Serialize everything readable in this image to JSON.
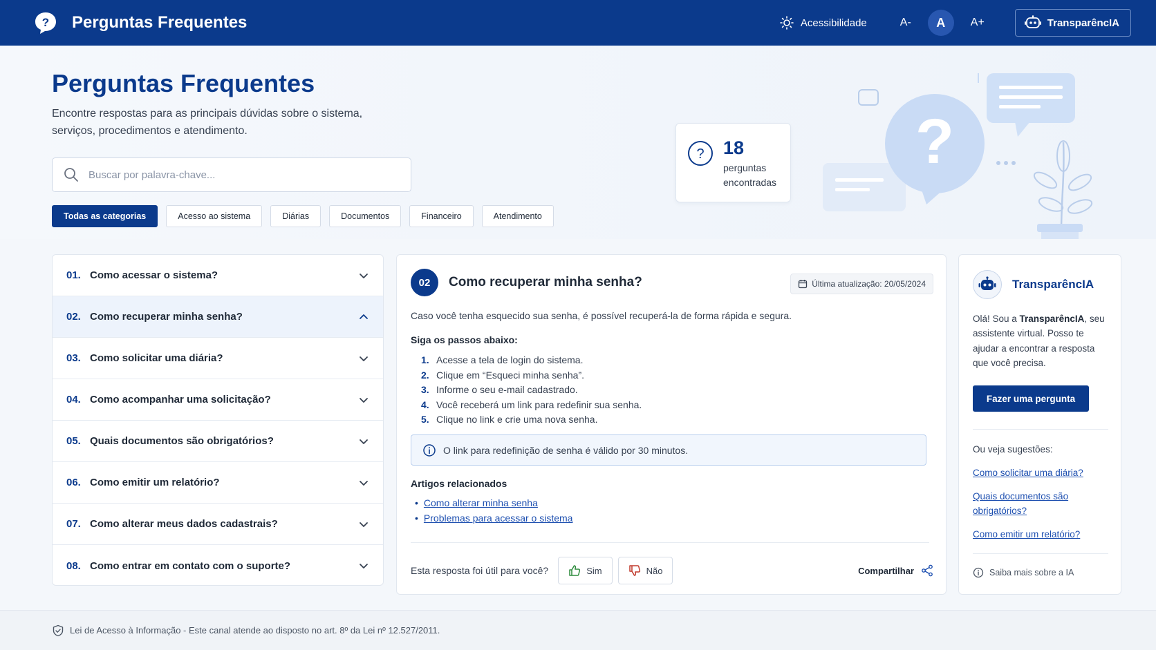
{
  "header": {
    "title": "Perguntas Frequentes",
    "accessibility_label": "Acessibilidade",
    "font_decrease": "A-",
    "font_normal": "A",
    "font_increase": "A+",
    "assistant_button": "TransparêncIA",
    "bg_color": "#0b3a8c"
  },
  "hero": {
    "title": "Perguntas Frequentes",
    "subtitle": "Encontre respostas para as principais dúvidas sobre o sistema, serviços, procedimentos e atendimento.",
    "search_placeholder": "Buscar por palavra-chave...",
    "categories": [
      {
        "label": "Todas as categorias",
        "active": true
      },
      {
        "label": "Acesso ao sistema",
        "active": false
      },
      {
        "label": "Diárias",
        "active": false
      },
      {
        "label": "Documentos",
        "active": false
      },
      {
        "label": "Financeiro",
        "active": false
      },
      {
        "label": "Atendimento",
        "active": false
      }
    ],
    "count": "18",
    "count_label": "perguntas encontradas"
  },
  "faq": {
    "items": [
      {
        "num": "01.",
        "question": "Como acessar o sistema?",
        "active": false
      },
      {
        "num": "02.",
        "question": "Como recuperar minha senha?",
        "active": true
      },
      {
        "num": "03.",
        "question": "Como solicitar uma diária?",
        "active": false
      },
      {
        "num": "04.",
        "question": "Como acompanhar uma solicitação?",
        "active": false
      },
      {
        "num": "05.",
        "question": "Quais documentos são obrigatórios?",
        "active": false
      },
      {
        "num": "06.",
        "question": "Como emitir um relatório?",
        "active": false
      },
      {
        "num": "07.",
        "question": "Como alterar meus dados cadastrais?",
        "active": false
      },
      {
        "num": "08.",
        "question": "Como entrar em contato com o suporte?",
        "active": false
      }
    ]
  },
  "answer": {
    "number": "02",
    "title": "Como recuperar minha senha?",
    "last_update": "Última atualização: 20/05/2024",
    "intro": "Caso você tenha esquecido sua senha, é possível recuperá-la de forma rápida e segura.",
    "steps_heading": "Siga os passos abaixo:",
    "steps": [
      {
        "n": "1.",
        "text": "Acesse a tela de login do sistema."
      },
      {
        "n": "2.",
        "text": "Clique em “Esqueci minha senha”."
      },
      {
        "n": "3.",
        "text": "Informe o seu e-mail cadastrado."
      },
      {
        "n": "4.",
        "text": "Você receberá um link para redefinir sua senha."
      },
      {
        "n": "5.",
        "text": "Clique no link e crie uma nova senha."
      }
    ],
    "notice": "O link para redefinição de senha é válido por 30 minutos.",
    "related_heading": "Artigos relacionados",
    "related": [
      "Como alterar minha senha",
      "Problemas para acessar o sistema"
    ],
    "feedback_question": "Esta resposta foi útil para você?",
    "yes_label": "Sim",
    "no_label": "Não",
    "share_label": "Compartilhar"
  },
  "assistant": {
    "name": "TransparêncIA",
    "greeting_prefix": "Olá! Sou a ",
    "greeting_name": "TransparêncIA",
    "greeting_suffix": ", seu assistente virtual. Posso te ajudar a encontrar a resposta que você precisa.",
    "ask_button": "Fazer uma pergunta",
    "suggestions_heading": "Ou veja sugestões:",
    "suggestions": [
      "Como solicitar uma diária?",
      "Quais documentos são obrigatórios?",
      "Como emitir um relatório?"
    ],
    "more_label": "Saiba mais sobre a IA"
  },
  "footer": {
    "text": "Lei de Acesso à Informação - Este canal atende ao disposto no art. 8º da Lei nº 12.527/2011."
  }
}
